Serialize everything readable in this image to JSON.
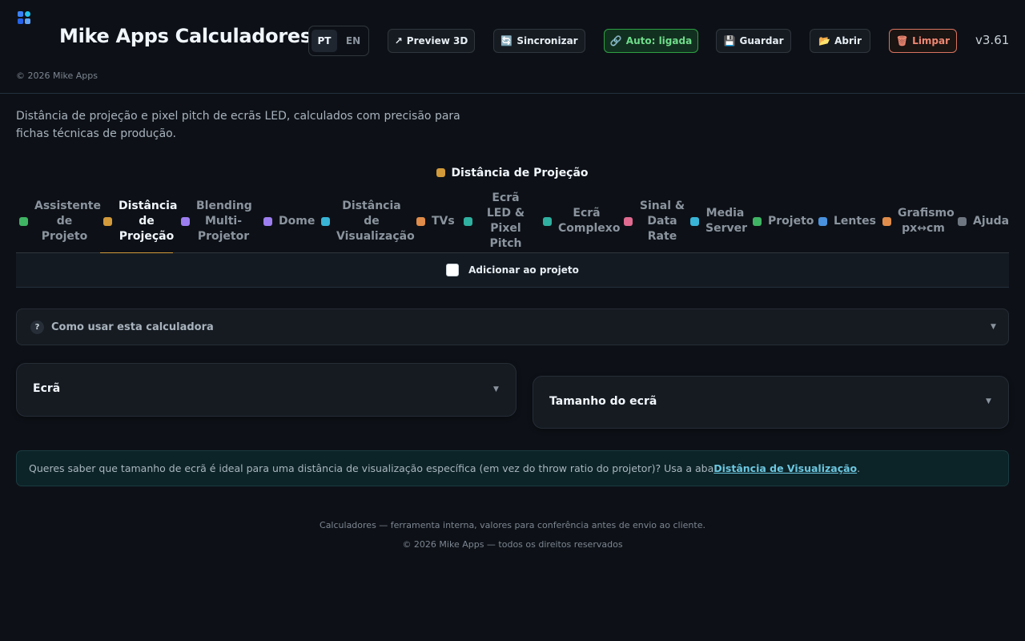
{
  "app": {
    "title": "Mike Apps Calculadores",
    "copyright": "© 2026 Mike Apps",
    "version": "v3.61"
  },
  "language": {
    "options": [
      "PT",
      "EN"
    ],
    "selected": "PT"
  },
  "toolbar": {
    "preview": {
      "icon": "↗",
      "label": "Preview 3D"
    },
    "sync": {
      "icon": "🔄",
      "label": "Sincronizar"
    },
    "auto": {
      "icon": "🔗",
      "label": "Auto: ligada"
    },
    "save": {
      "icon": "💾",
      "label": "Guardar"
    },
    "open": {
      "icon": "📂",
      "label": "Abrir"
    },
    "clear": {
      "icon": "🗑",
      "label": "Limpar"
    }
  },
  "intro": "Distância de projeção e pixel pitch de ecrãs LED, calculados com precisão para fichas técnicas de produção.",
  "active_tab_title": "Distância de Projeção",
  "tabs": [
    {
      "label": "Assistente de Projeto",
      "color": "#3fb463"
    },
    {
      "label": "Distância de Projeção",
      "color": "#d29a3a",
      "active": true
    },
    {
      "label": "Blending Multi-Projetor",
      "color": "#9d7ef0"
    },
    {
      "label": "Dome",
      "color": "#9d7ef0"
    },
    {
      "label": "Distância de Visualização",
      "color": "#39b4d6"
    },
    {
      "label": "TVs",
      "color": "#e08c4a"
    },
    {
      "label": "Ecrã LED & Pixel Pitch",
      "color": "#2fb0a0"
    },
    {
      "label": "Ecrã Complexo",
      "color": "#2fb0a0"
    },
    {
      "label": "Sinal & Data Rate",
      "color": "#e06a90"
    },
    {
      "label": "Media Server",
      "color": "#39b4d6"
    },
    {
      "label": "Projeto",
      "color": "#3fb463"
    },
    {
      "label": "Lentes",
      "color": "#4a92de"
    },
    {
      "label": "Grafismo px↔cm",
      "color": "#e08c4a"
    },
    {
      "label": "Ajuda",
      "color": "#6e7681"
    }
  ],
  "add_to_project": {
    "label": "Adicionar ao projeto",
    "checked": false
  },
  "howto": {
    "icon": "?",
    "label": "Como usar esta calculadora"
  },
  "panels": {
    "screen": "Ecrã",
    "screen_size": "Tamanho do ecrã"
  },
  "info": {
    "text": "Queres saber que tamanho de ecrã é ideal para uma distância de visualização específica (em vez do throw ratio do projetor)? Usa a aba ",
    "link": "Distância de Visualização",
    "suffix": "."
  },
  "footer": {
    "line1": "Calculadores — ferramenta interna, valores para conferência antes de envio ao cliente.",
    "line2": "© 2026 Mike Apps — todos os direitos reservados"
  }
}
